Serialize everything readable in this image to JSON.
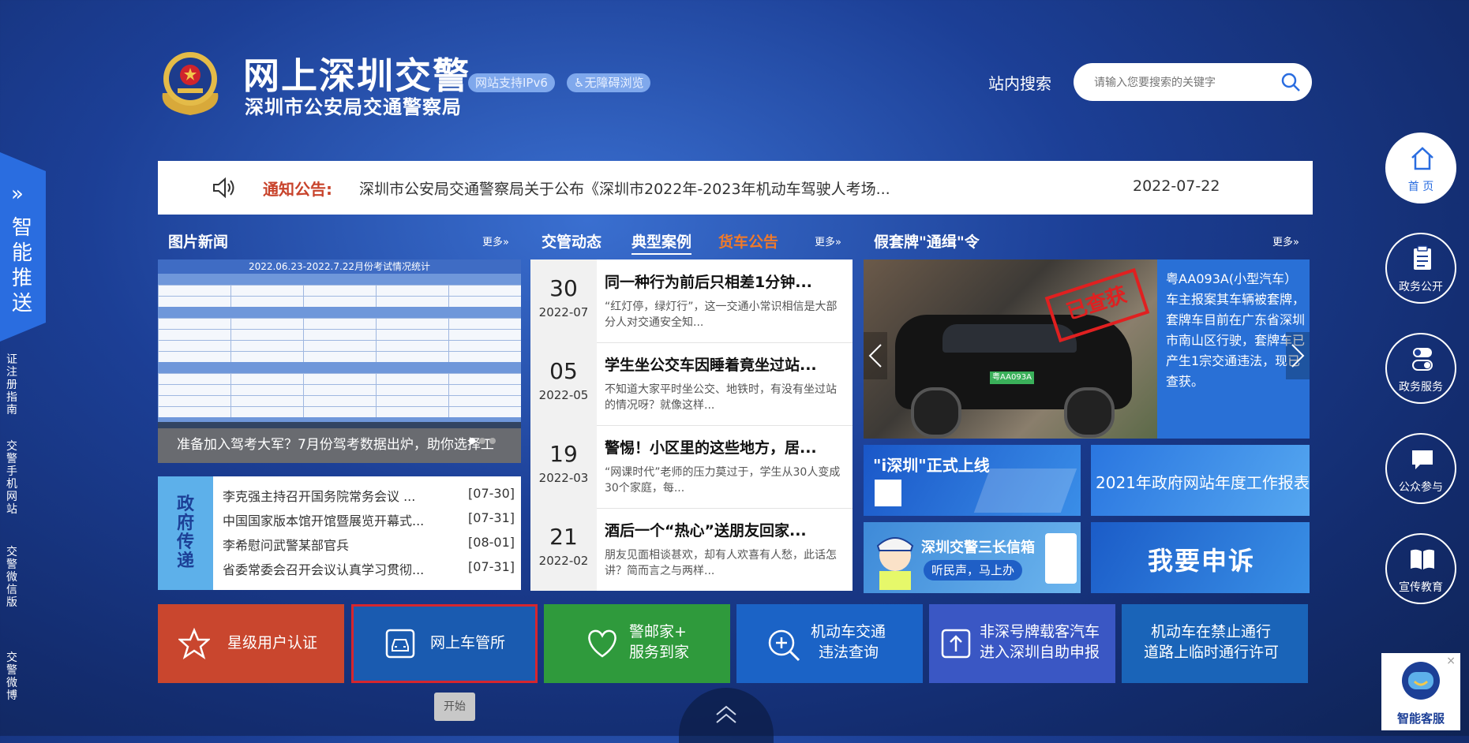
{
  "header": {
    "title": "网上深圳交警",
    "subtitle": "深圳市公安局交通警察局",
    "badge_ipv6": "网站支持IPv6",
    "badge_a11y": "无障碍浏览",
    "search_label": "站内搜索",
    "search_placeholder": "请输入您要搜索的关键字"
  },
  "notice": {
    "label": "通知公告:",
    "text": "深圳市公安局交通警察局关于公布《深圳市2022年-2023年机动车驾驶人考场...",
    "date": "2022-07-22"
  },
  "picture_news": {
    "title": "图片新闻",
    "more": "更多»",
    "table_title": "2022.06.23-2022.7.22月份考试情况统计",
    "caption": "准备加入驾考大军？7月份驾考数据出炉，助你选择工"
  },
  "gov_relay": {
    "label": "政府传递",
    "items": [
      {
        "title": "李克强主持召开国务院常务会议 ...",
        "date": "[07-30]"
      },
      {
        "title": "中国国家版本馆开馆暨展览开幕式...",
        "date": "[07-31]"
      },
      {
        "title": "李希慰问武警某部官兵",
        "date": "[08-01]"
      },
      {
        "title": "省委常委会召开会议认真学习贯彻...",
        "date": "[07-31]"
      }
    ]
  },
  "traffic": {
    "tabs": [
      "交管动态",
      "典型案例",
      "货车公告"
    ],
    "more": "更多»",
    "items": [
      {
        "day": "30",
        "ym": "2022-07",
        "title": "同一种行为前后只相差1分钟...",
        "summary": "“红灯停，绿灯行”，这一交通小常识相信是大部分人对交通安全知..."
      },
      {
        "day": "05",
        "ym": "2022-05",
        "title": "学生坐公交车因睡着竟坐过站...",
        "summary": "不知道大家平时坐公交、地铁时，有没有坐过站的情况呀？就像这样..."
      },
      {
        "day": "19",
        "ym": "2022-03",
        "title": "警惕！小区里的这些地方，居...",
        "summary": "“网课时代”老师的压力莫过于，学生从30人变成30个家庭，每..."
      },
      {
        "day": "21",
        "ym": "2022-02",
        "title": "酒后一个“热心”送朋友回家...",
        "summary": "朋友见面相谈甚欢，却有人欢喜有人愁，此话怎讲？简而言之与两样..."
      }
    ]
  },
  "fake_plate": {
    "title": "假套牌\"通缉\"令",
    "more": "更多»",
    "stamp": "已查获",
    "plate": "粤AA093A",
    "text": "粤AA093A(小型汽车）车主报案其车辆被套牌，套牌车目前在广东省深圳市南山区行驶，套牌车已产生1宗交通违法，现已查获。"
  },
  "tiles": {
    "ishenzhen": "\"i深圳\"正式上线",
    "report": "2021年政府网站年度工作报表",
    "mailbox_title": "深圳交警三长信箱",
    "mailbox_tag": "听民声，马上办",
    "appeal": "我要申诉"
  },
  "services": [
    {
      "line1": "星级用户认证",
      "line2": ""
    },
    {
      "line1": "网上车管所",
      "line2": ""
    },
    {
      "line1": "警邮家+",
      "line2": "服务到家"
    },
    {
      "line1": "机动车交通",
      "line2": "违法查询"
    },
    {
      "line1": "非深号牌载客汽车",
      "line2": "进入深圳自助申报"
    },
    {
      "line1": "机动车在禁止通行",
      "line2": "道路上临时通行许可"
    }
  ],
  "tooltip": "开始",
  "left_push": {
    "chevron": "»",
    "label": "智能推送",
    "links": [
      "证注册指南",
      "交警手机网站",
      "交警微信版",
      "交警微博"
    ]
  },
  "right_nav": [
    {
      "label": "首 页"
    },
    {
      "label": "政务公开"
    },
    {
      "label": "政务服务"
    },
    {
      "label": "公众参与"
    },
    {
      "label": "宣传教育"
    }
  ],
  "ai_cs": {
    "label": "智能客服",
    "close": "×"
  },
  "colors": {
    "accent_red": "#c8432b",
    "primary_blue": "#2a6de0",
    "tab_orange": "#f07a2a"
  }
}
